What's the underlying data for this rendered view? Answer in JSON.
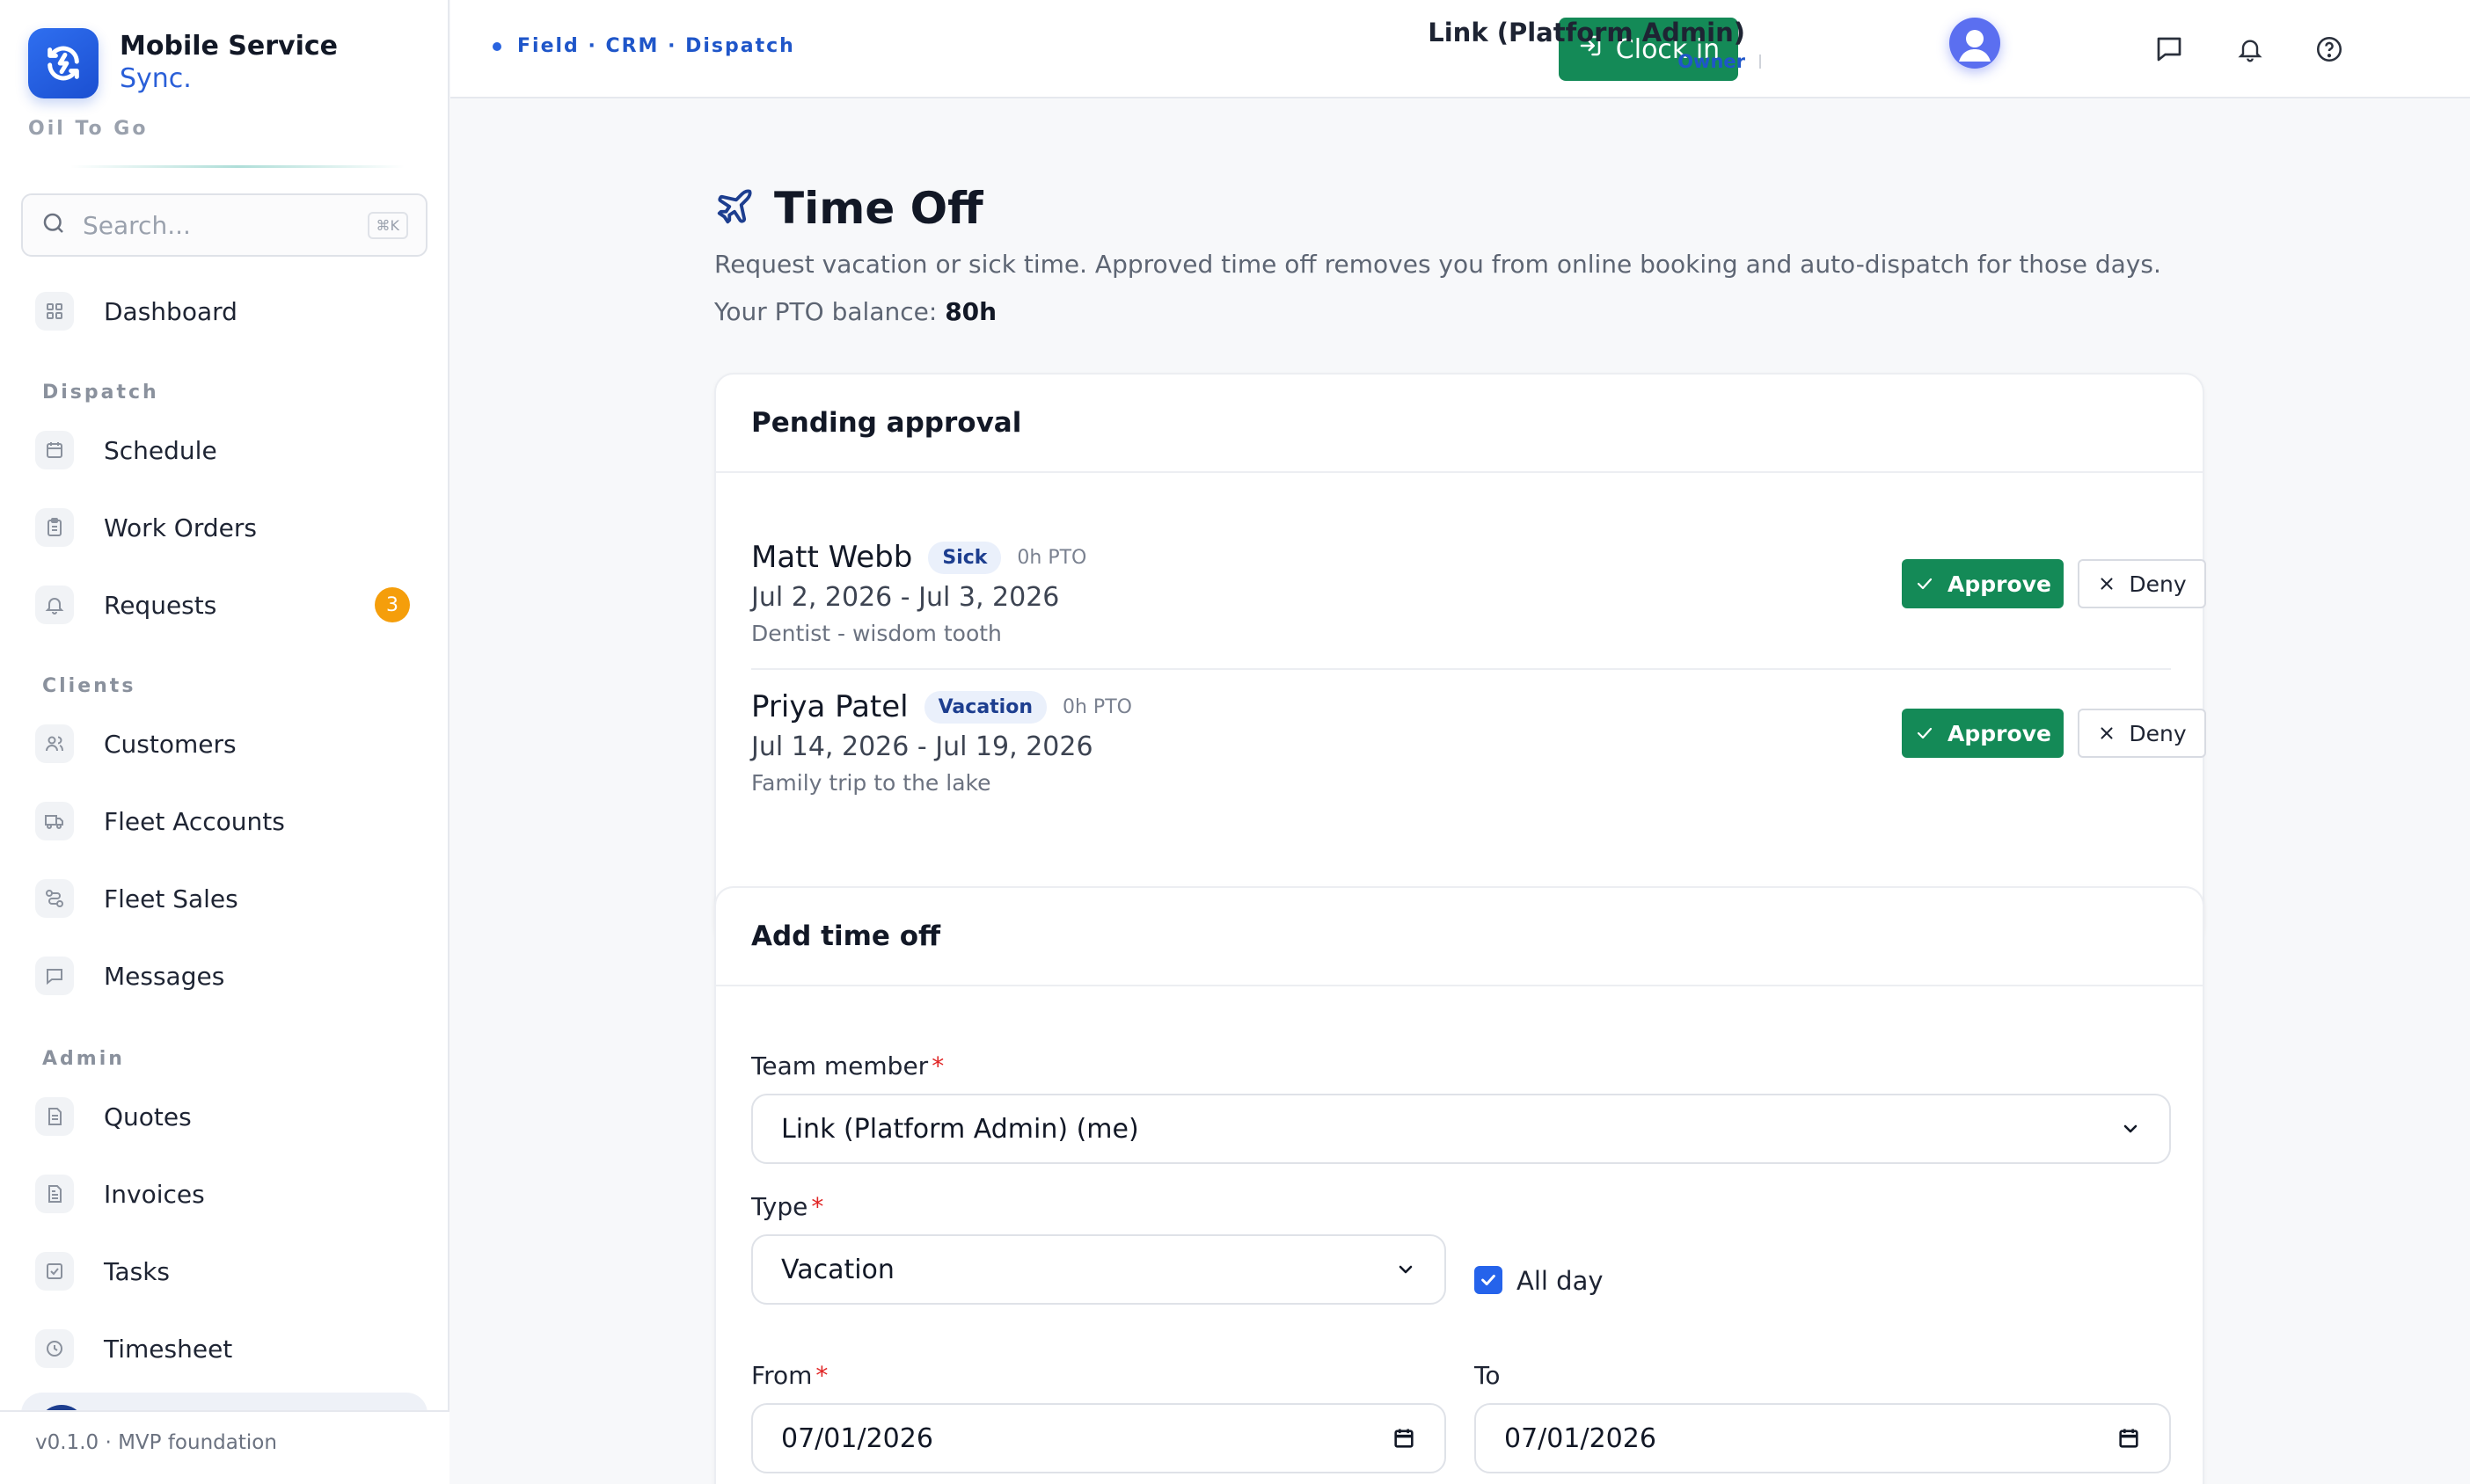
{
  "brand": {
    "name": "Mobile Service",
    "sub": "Sync.",
    "org": "Oil To Go"
  },
  "search": {
    "placeholder": "Search...",
    "shortcut": "⌘K"
  },
  "sidebar": {
    "items": [
      {
        "label": "Dashboard",
        "icon": "dashboard-grid-icon"
      },
      {
        "label": "Schedule",
        "icon": "calendar-icon"
      },
      {
        "label": "Work Orders",
        "icon": "clipboard-icon"
      },
      {
        "label": "Requests",
        "icon": "bell-icon",
        "badge": "3"
      },
      {
        "label": "Customers",
        "icon": "users-icon"
      },
      {
        "label": "Fleet Accounts",
        "icon": "truck-icon"
      },
      {
        "label": "Fleet Sales",
        "icon": "route-icon"
      },
      {
        "label": "Messages",
        "icon": "message-icon"
      },
      {
        "label": "Quotes",
        "icon": "document-icon"
      },
      {
        "label": "Invoices",
        "icon": "invoice-icon"
      },
      {
        "label": "Tasks",
        "icon": "checkbox-icon"
      },
      {
        "label": "Timesheet",
        "icon": "clock-icon"
      }
    ],
    "sections": {
      "dispatch": "Dispatch",
      "clients": "Clients",
      "admin": "Admin"
    },
    "footer": "v0.1.0 · MVP foundation"
  },
  "topbar": {
    "breadcrumb": "Field · CRM · Dispatch",
    "clock_in": "Clock in",
    "user_name": "Link (Platform Admin)",
    "user_role": "Owner"
  },
  "page": {
    "title": "Time Off",
    "description": "Request vacation or sick time. Approved time off removes you from online booking and auto-dispatch for those days.",
    "pto_label": "Your PTO balance:",
    "pto_value": "80h"
  },
  "pending": {
    "title": "Pending approval",
    "approve_label": "Approve",
    "deny_label": "Deny",
    "requests": [
      {
        "name": "Matt Webb",
        "type": "Sick",
        "pto": "0h PTO",
        "dates": "Jul 2, 2026 - Jul 3, 2026",
        "note": "Dentist - wisdom tooth"
      },
      {
        "name": "Priya Patel",
        "type": "Vacation",
        "pto": "0h PTO",
        "dates": "Jul 14, 2026 - Jul 19, 2026",
        "note": "Family trip to the lake"
      }
    ]
  },
  "form": {
    "title": "Add time off",
    "team_member_label": "Team member",
    "team_member_value": "Link (Platform Admin) (me)",
    "type_label": "Type",
    "type_value": "Vacation",
    "all_day_label": "All day",
    "all_day_checked": true,
    "from_label": "From",
    "from_value": "07/01/2026",
    "to_label": "To",
    "to_value": "07/01/2026",
    "required_mark": "*"
  },
  "colors": {
    "accent": "#1f56c9",
    "success": "#148a57",
    "badge": "#f59e0b",
    "required": "#e02424"
  }
}
